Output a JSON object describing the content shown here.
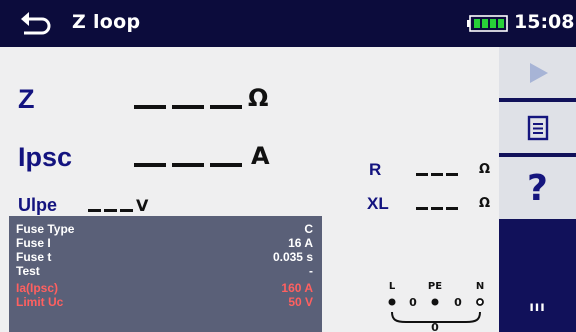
{
  "titlebar": {
    "title": "Z loop",
    "time": "15:08",
    "back_icon": "back-arrow-icon",
    "battery_icon": "battery-icon"
  },
  "results": {
    "z": {
      "label": "Z",
      "value": "___",
      "unit": "Ω"
    },
    "ipsc": {
      "label": "Ipsc",
      "value": "___",
      "unit": "A"
    },
    "ulpe": {
      "label": "Ulpe",
      "value": "___",
      "unit": "V"
    },
    "r": {
      "label": "R",
      "value": "___",
      "unit": "Ω"
    },
    "xl": {
      "label": "XL",
      "value": "___",
      "unit": "Ω"
    }
  },
  "parameters": [
    {
      "label": "Fuse Type",
      "value": "C",
      "status": "normal"
    },
    {
      "label": "Fuse I",
      "value": "16 A",
      "status": "normal"
    },
    {
      "label": "Fuse t",
      "value": "0.035 s",
      "status": "normal"
    },
    {
      "label": "Test",
      "value": "-",
      "status": "normal"
    },
    {
      "label": "Ia(Ipsc)",
      "value": "160 A",
      "status": "limit"
    },
    {
      "label": "Limit Uc",
      "value": "50 V",
      "status": "limit"
    }
  ],
  "terminals": {
    "l": "L",
    "pe": "PE",
    "n": "N",
    "l_pe": "0",
    "pe_n": "0",
    "l_n": "0"
  },
  "sidebar": {
    "run_icon": "play-icon",
    "list_icon": "list-icon",
    "help_label": "?",
    "more_label": "ııı"
  },
  "colors": {
    "titlebar_bg": "#0c0c3c",
    "sidebar_bg": "#11115a",
    "result_label": "#13137f",
    "param_panel_bg": "#5a6078",
    "limit_text": "#ff6060"
  }
}
